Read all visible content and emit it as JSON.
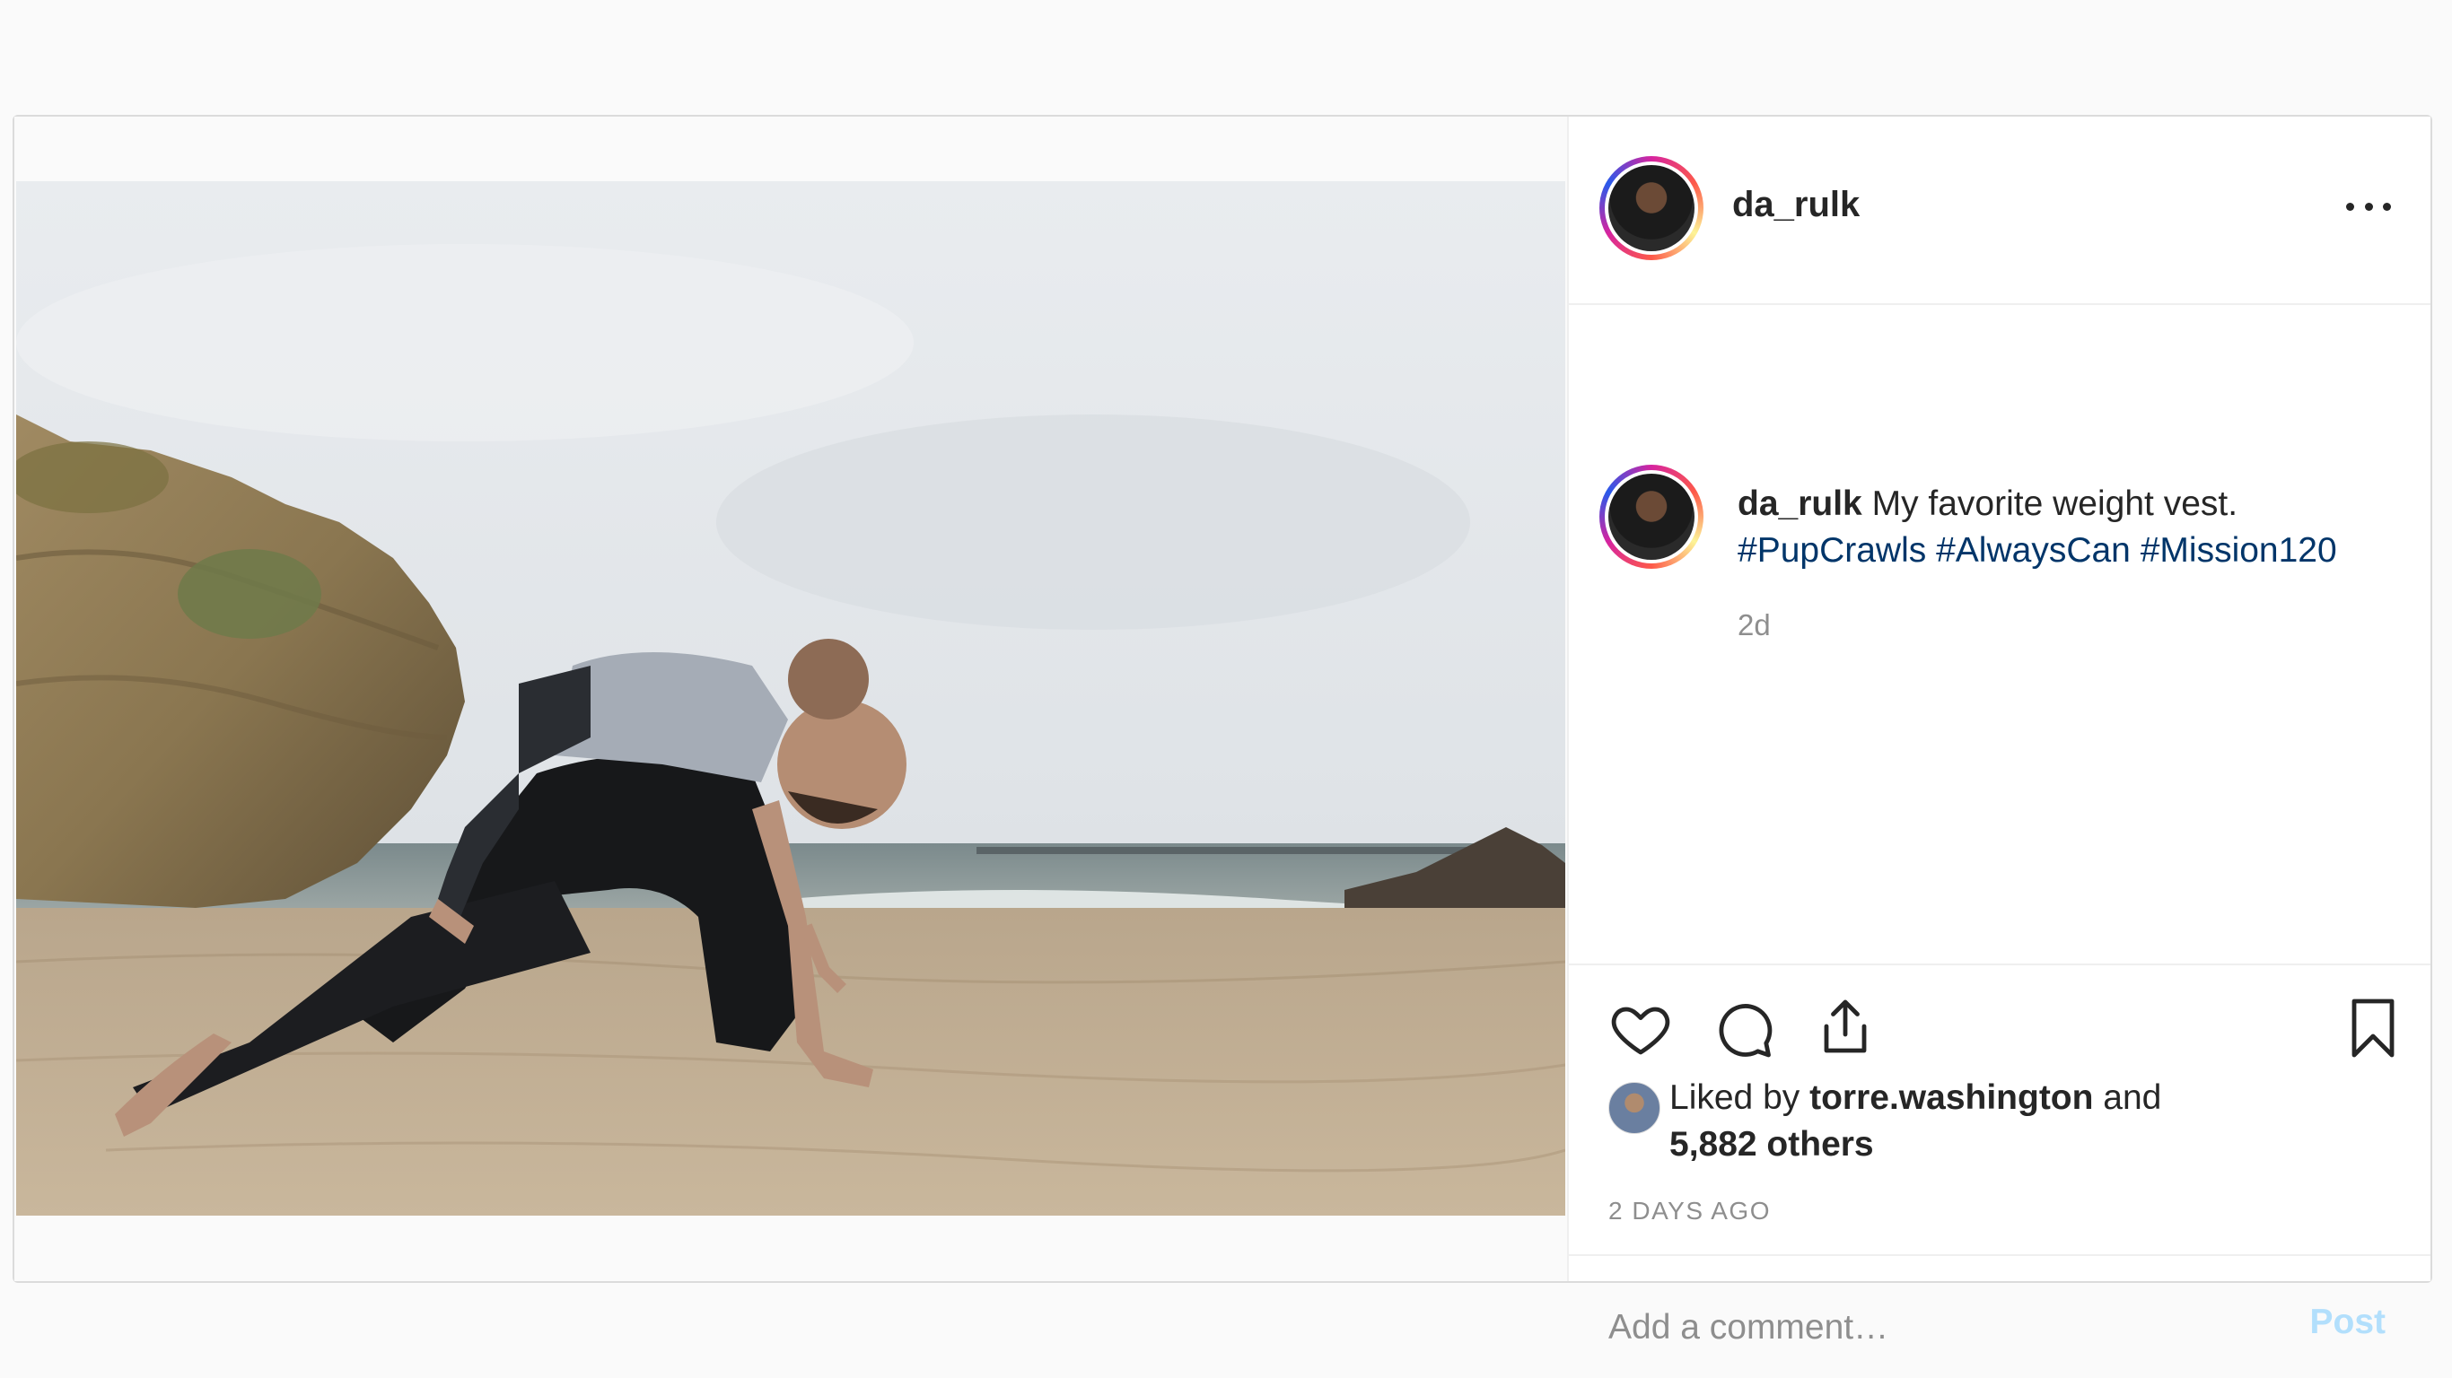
{
  "post": {
    "author": "da_rulk",
    "more_icon": "more-horizontal-icon",
    "caption": {
      "username": "da_rulk",
      "text": "My favorite weight vest.",
      "hashtags": [
        "#PupCrawls",
        "#AlwaysCan",
        "#Mission120"
      ],
      "relative_time": "2d"
    },
    "actions": {
      "like_icon": "heart-icon",
      "comment_icon": "comment-bubble-icon",
      "share_icon": "share-upload-icon",
      "save_icon": "bookmark-icon"
    },
    "likes": {
      "prefix": "Liked by",
      "liker": "torre.washington",
      "joiner": "and",
      "others": "5,882 others"
    },
    "timestamp": "2 DAYS AGO",
    "comment": {
      "placeholder": "Add a comment…",
      "post_label": "Post"
    }
  },
  "colors": {
    "page_bg": "#fafafa",
    "hashtag": "#003569",
    "muted": "#8e8e8e",
    "post_button": "#b2dffc"
  }
}
